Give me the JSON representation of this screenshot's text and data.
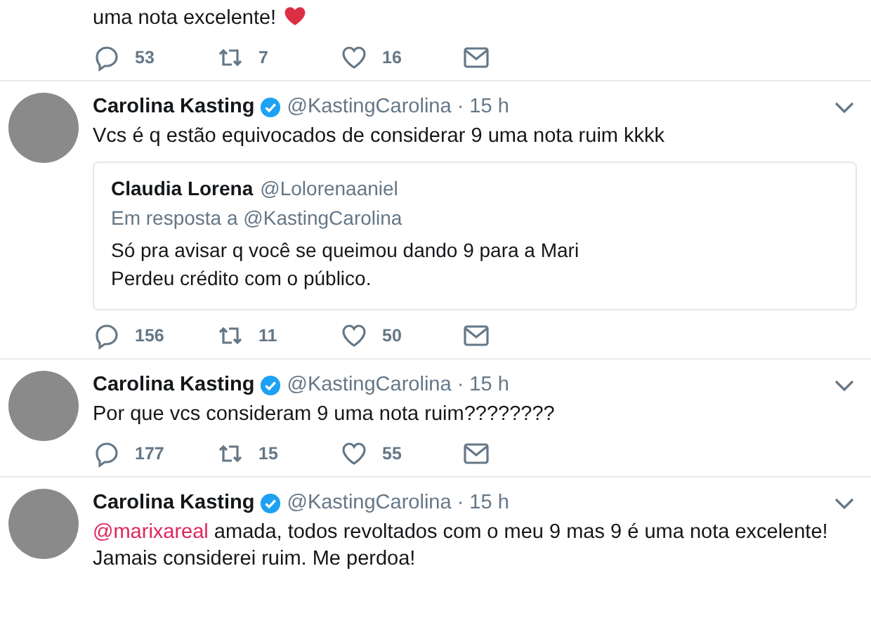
{
  "tweets": [
    {
      "kind": "fragment",
      "body": [
        {
          "kind": "text",
          "text": "uma nota excelente!"
        },
        {
          "kind": "heart"
        }
      ],
      "actions": {
        "replies": "53",
        "retweets": "7",
        "likes": "16"
      }
    },
    {
      "kind": "full",
      "name": "Carolina Kasting",
      "verified": true,
      "handle": "@KastingCarolina",
      "time": "· 15 h",
      "body": [
        {
          "kind": "text",
          "text": "Vcs é q estão equivocados de considerar 9 uma nota ruim kkkk"
        }
      ],
      "quote": {
        "name": "Claudia Lorena",
        "handle": "@Lolorenaaniel",
        "reply_to": "Em resposta a @KastingCarolina",
        "lines": [
          "Só pra avisar q você se queimou dando 9 para a Mari",
          "Perdeu crédito com o público."
        ]
      },
      "actions": {
        "replies": "156",
        "retweets": "11",
        "likes": "50"
      }
    },
    {
      "kind": "full",
      "name": "Carolina Kasting",
      "verified": true,
      "handle": "@KastingCarolina",
      "time": "· 15 h",
      "body": [
        {
          "kind": "text",
          "text": "Por que vcs consideram 9 uma nota ruim????????"
        }
      ],
      "actions": {
        "replies": "177",
        "retweets": "15",
        "likes": "55"
      }
    },
    {
      "kind": "full",
      "name": "Carolina Kasting",
      "verified": true,
      "handle": "@KastingCarolina",
      "time": "· 15 h",
      "body": [
        {
          "kind": "mention",
          "text": "@marixareal"
        },
        {
          "kind": "text",
          "text": " amada, todos revoltados com o meu 9 mas 9 é uma nota excelente! Jamais considerei ruim. Me perdoa!"
        }
      ]
    }
  ]
}
